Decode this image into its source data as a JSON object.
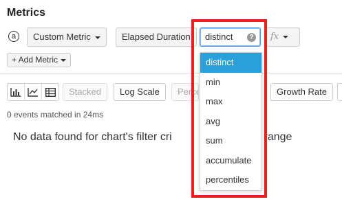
{
  "section": {
    "title": "Metrics"
  },
  "metric": {
    "badge": "a",
    "custom_metric_label": "Custom Metric",
    "field_label": "Elapsed Duration",
    "aggregation_value": "distinct",
    "help_glyph": "?",
    "fx_label": "fx"
  },
  "add_metric": {
    "label": "+ Add Metric"
  },
  "toolbar": {
    "stacked_label": "Stacked",
    "log_scale_label": "Log Scale",
    "percent_label": "Perce",
    "growth_rate_label": "Growth Rate"
  },
  "status": {
    "events_matched": "0 events matched in 24ms",
    "no_data": "No data found for chart's filter cri",
    "no_data_tail": "te range"
  },
  "dropdown": {
    "options": [
      {
        "label": "distinct",
        "selected": true
      },
      {
        "label": "min"
      },
      {
        "label": "max"
      },
      {
        "label": "avg"
      },
      {
        "label": "sum"
      },
      {
        "label": "accumulate"
      },
      {
        "label": "percentiles"
      }
    ]
  },
  "colors": {
    "highlight": "#e8211c",
    "selected_option": "#2b9fd9",
    "focus_border": "#4a90e2"
  }
}
